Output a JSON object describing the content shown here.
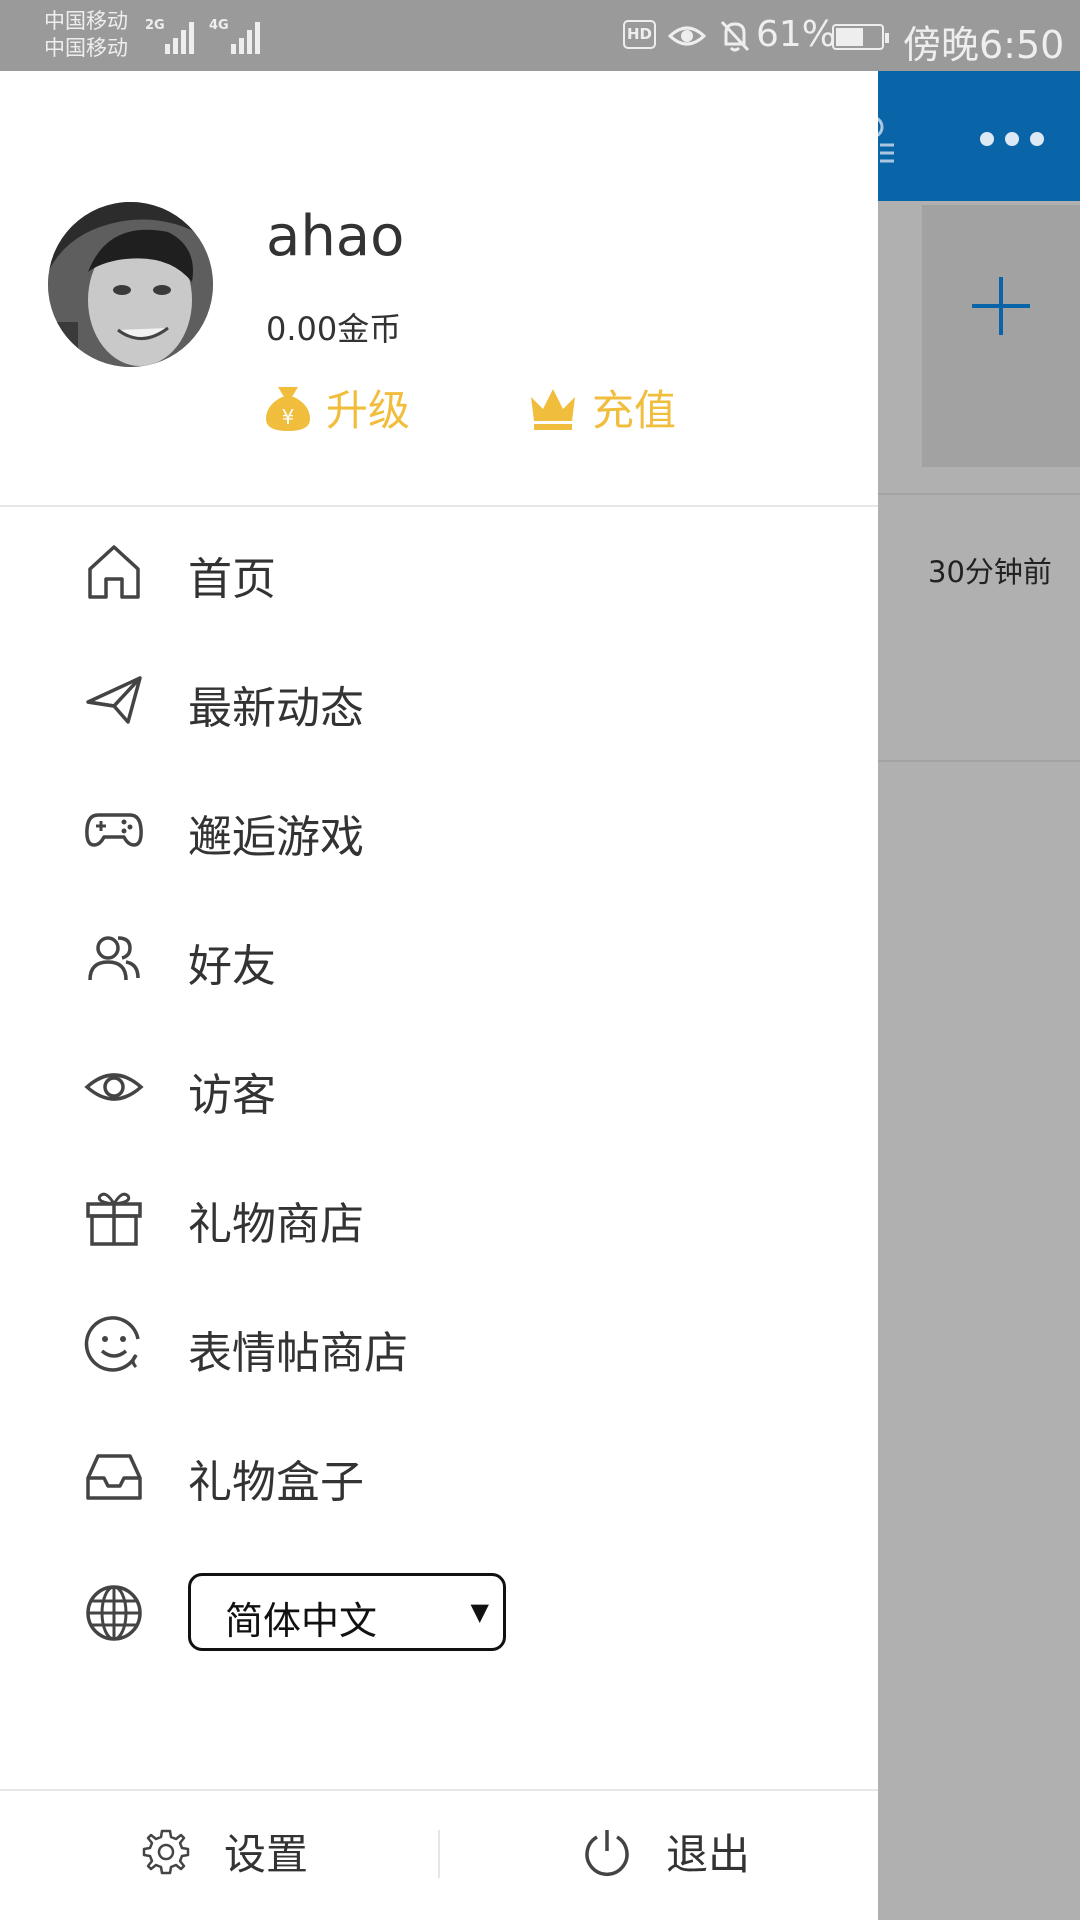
{
  "status_bar": {
    "carrier_1": "中国移动",
    "carrier_2": "中国移动",
    "signal_1_label": "2G",
    "signal_2_label": "4G",
    "hd_badge": "HD",
    "battery_percent": "61%",
    "battery_level": 0.61,
    "time": "傍晚6:50"
  },
  "background_app": {
    "header_color": "#0a64a8",
    "list_item_time": "30分钟前",
    "add_icon": "plus-icon",
    "more_icon": "more-horizontal-icon"
  },
  "profile": {
    "username": "ahao",
    "coins": "0.00金币",
    "upgrade_label": "升级",
    "upgrade_icon": "money-bag-icon",
    "recharge_label": "充值",
    "recharge_icon": "crown-icon",
    "accent_color": "#f1bd3d"
  },
  "menu": {
    "items": [
      {
        "label": "首页",
        "icon": "home-icon"
      },
      {
        "label": "最新动态",
        "icon": "paper-plane-icon"
      },
      {
        "label": "邂逅游戏",
        "icon": "gamepad-icon"
      },
      {
        "label": "好友",
        "icon": "friends-icon"
      },
      {
        "label": "访客",
        "icon": "eye-icon"
      },
      {
        "label": "礼物商店",
        "icon": "gift-icon"
      },
      {
        "label": "表情帖商店",
        "icon": "smiley-icon"
      },
      {
        "label": "礼物盒子",
        "icon": "inbox-icon"
      }
    ]
  },
  "language": {
    "icon": "globe-icon",
    "selected": "简体中文",
    "caret": "▼"
  },
  "footer": {
    "settings_label": "设置",
    "settings_icon": "gear-icon",
    "logout_label": "退出",
    "logout_icon": "power-icon"
  }
}
